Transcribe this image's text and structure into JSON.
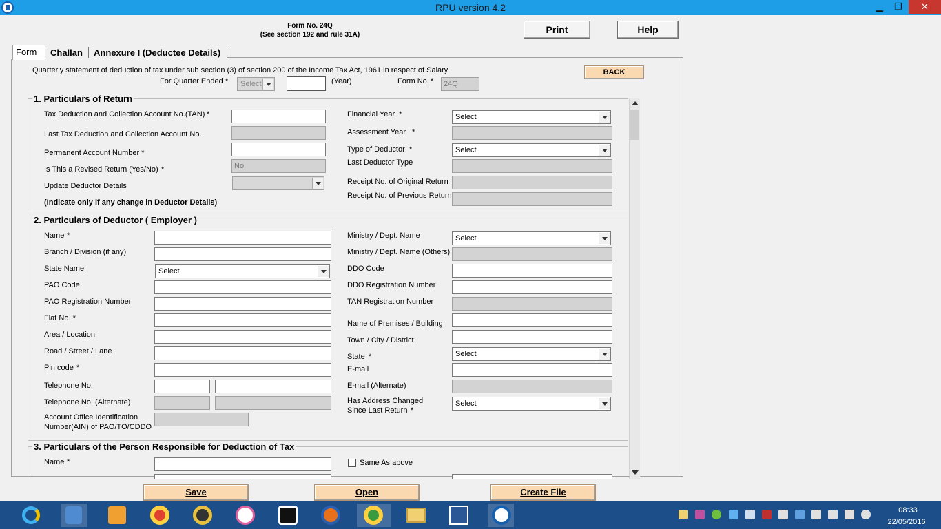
{
  "window": {
    "title": "RPU version 4.2",
    "minimize": "▁",
    "restore": "❐",
    "close": "✕"
  },
  "header": {
    "form_title": "Form No. 24Q",
    "form_subtitle": "(See section 192 and rule 31A)",
    "print_label": "Print",
    "help_label": "Help"
  },
  "tabs": [
    {
      "label": "Form"
    },
    {
      "label": "Challan"
    },
    {
      "label": "Annexure I (Deductee Details)"
    }
  ],
  "intro": {
    "statement": "Quarterly statement of deduction of tax under sub section (3) of section 200 of the Income Tax Act, 1961 in respect of Salary",
    "quarter_label": "For Quarter Ended",
    "quarter_value": "Select",
    "year_value": "",
    "year_suffix": "(Year)",
    "form_no_label": "Form No.",
    "form_no_value": "24Q",
    "back_label": "BACK",
    "star": "*"
  },
  "section1": {
    "title": "1. Particulars of Return",
    "tan_label": "Tax Deduction and Collection Account No.(TAN)",
    "last_tan_label": "Last Tax Deduction and Collection Account No.",
    "pan_label": "Permanent Account Number *",
    "revised_label": "Is This a Revised Return (Yes/No)",
    "revised_value": "No",
    "update_label": "Update Deductor Details",
    "indicate_note": "(Indicate only if any change in Deductor Details)",
    "fy_label": "Financial Year",
    "fy_value": "Select",
    "ay_label": "Assessment Year",
    "deductor_type_label": "Type of Deductor",
    "deductor_type_value": "Select",
    "last_deductor_type_label": "Last Deductor Type",
    "receipt_original_label": "Receipt No. of Original Return",
    "receipt_previous_label": "Receipt No. of Previous Return"
  },
  "section2": {
    "title": "2. Particulars of Deductor ( Employer )",
    "name_label": "Name",
    "branch_label": "Branch / Division (if any)",
    "state_name_label": "State Name",
    "state_name_value": "Select",
    "pao_code_label": "PAO Code",
    "pao_reg_label": "PAO Registration Number",
    "flat_label": "Flat No. *",
    "area_label": "Area / Location",
    "road_label": "Road / Street / Lane",
    "pin_label": "Pin code",
    "tel_label": "Telephone No.",
    "tel_alt_label": "Telephone No. (Alternate)",
    "ain_label_1": "Account Office Identification",
    "ain_label_2": "Number(AIN) of PAO/TO/CDDO",
    "ministry_label": "Ministry / Dept. Name",
    "ministry_value": "Select",
    "ministry_others_label": "Ministry / Dept. Name (Others)",
    "ddo_code_label": "DDO Code",
    "ddo_reg_label": "DDO Registration Number",
    "tan_reg_label": "TAN Registration Number",
    "premises_label": "Name of Premises / Building",
    "town_label": "Town / City / District",
    "state_label": "State",
    "state_value": "Select",
    "email_label": "E-mail",
    "email_alt_label": "E-mail (Alternate)",
    "addr_changed_label_1": "Has Address Changed",
    "addr_changed_label_2": "Since Last Return",
    "addr_changed_value": "Select"
  },
  "section3": {
    "title": "3. Particulars of the Person Responsible for Deduction of Tax",
    "name_label": "Name",
    "same_as_above_label": "Same As above"
  },
  "footer": {
    "save_label": "Save",
    "open_label": "Open",
    "create_file_label": "Create File"
  },
  "taskbar": {
    "time": "08:33",
    "date": "22/05/2016",
    "apps": [
      "internet-explorer-icon",
      "media-center-icon",
      "outlook-icon",
      "chrome-icon",
      "daemon-tools-icon",
      "itunes-icon",
      "whatsapp-icon",
      "firefox-icon",
      "chrome-user-icon",
      "file-explorer-icon",
      "word-icon",
      "rpu-app-icon"
    ]
  }
}
